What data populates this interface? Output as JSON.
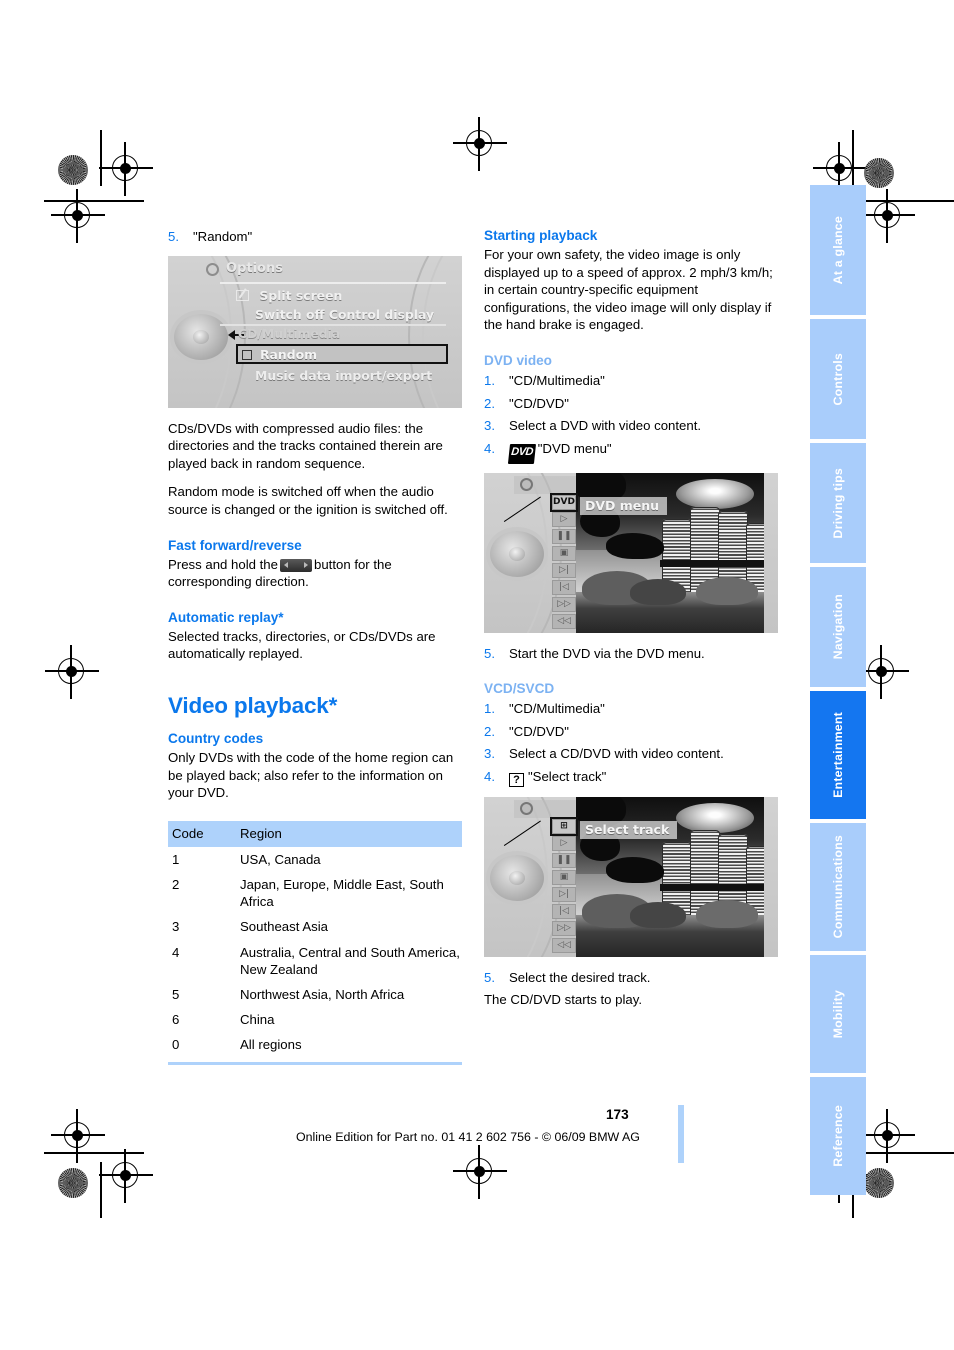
{
  "page": {
    "number": "173",
    "footer_note": "Online Edition for Part no. 01 41 2 602 756 - © 06/09 BMW AG"
  },
  "left_column": {
    "step5_random": {
      "num": "5.",
      "text": "\"Random\""
    },
    "options_screenshot": {
      "title_bar": "Options",
      "gear_icon": "gear-icon",
      "menu_items": [
        {
          "label": "Split screen",
          "checkbox": "checked"
        },
        {
          "label": "Switch off Control display",
          "checkbox": "none"
        },
        {
          "label": "CD/Multimedia",
          "checkbox": "none"
        },
        {
          "label": "Random",
          "checkbox": "unchecked",
          "selected": true
        },
        {
          "label": "Music data import/export",
          "checkbox": "none"
        }
      ]
    },
    "paragraphs": [
      "CDs/DVDs with compressed audio files: the directories and the tracks contained therein are played back in random sequence.",
      "Random mode is switched off when the audio source is changed or the ignition is switched off."
    ],
    "fast_forward": {
      "heading": "Fast forward/reverse",
      "text_before": "Press and hold the",
      "button_icon": "rocker-button-icon",
      "text_after": "button for the corresponding direction."
    },
    "automatic_replay": {
      "heading": "Automatic replay*",
      "text": "Selected tracks, directories, or CDs/DVDs are automatically replayed."
    },
    "video_playback": {
      "heading": "Video playback*",
      "country_codes": {
        "heading": "Country codes",
        "intro": "Only DVDs with the code of the home region can be played back; also refer to the information on your DVD.",
        "columns": [
          "Code",
          "Region"
        ],
        "rows": [
          {
            "code": "1",
            "region": "USA, Canada"
          },
          {
            "code": "2",
            "region": "Japan, Europe, Middle East, South Africa"
          },
          {
            "code": "3",
            "region": "Southeast Asia"
          },
          {
            "code": "4",
            "region": "Australia, Central and South America, New Zealand"
          },
          {
            "code": "5",
            "region": "Northwest Asia, North Africa"
          },
          {
            "code": "6",
            "region": "China"
          },
          {
            "code": "0",
            "region": "All regions"
          }
        ]
      }
    }
  },
  "right_column": {
    "starting_playback": {
      "heading": "Starting playback",
      "text": "For your own safety, the video image is only displayed up to a speed of approx. 2 mph/3 km/h; in certain country-specific equipment configurations, the video image will only display if the hand brake is engaged."
    },
    "dvd_video": {
      "heading": "DVD video",
      "steps": [
        {
          "num": "1.",
          "text": "\"CD/Multimedia\""
        },
        {
          "num": "2.",
          "text": "\"CD/DVD\""
        },
        {
          "num": "3.",
          "text": "Select a DVD with video content."
        },
        {
          "num": "4.",
          "icon": "dvd-logo-icon",
          "icon_text": "DVD",
          "text": "\"DVD menu\""
        }
      ],
      "screenshot": {
        "gear_icon": "gear-icon",
        "selected_label": "DVD menu",
        "selected_icon": "dvd-logo-icon",
        "control_icons": [
          "dvd",
          "play",
          "pause",
          "stop",
          "next-track",
          "previous-track",
          "fast-forward",
          "rewind"
        ],
        "video_content": "BMW four-cylinder tower building"
      },
      "step5": {
        "num": "5.",
        "text": "Start the DVD via the DVD menu."
      }
    },
    "vcd_svcd": {
      "heading": "VCD/SVCD",
      "steps": [
        {
          "num": "1.",
          "text": "\"CD/Multimedia\""
        },
        {
          "num": "2.",
          "text": "\"CD/DVD\""
        },
        {
          "num": "3.",
          "text": "Select a CD/DVD with video content."
        },
        {
          "num": "4.",
          "icon": "question-box-icon",
          "icon_text": "?",
          "text": "\"Select track\""
        }
      ],
      "screenshot": {
        "gear_icon": "gear-icon",
        "selected_label": "Select track",
        "selected_icon": "select-track-icon",
        "control_icons": [
          "select-track",
          "play",
          "pause",
          "stop",
          "next-track",
          "previous-track",
          "fast-forward",
          "rewind"
        ],
        "video_content": "BMW four-cylinder tower building"
      },
      "step5": {
        "num": "5.",
        "text": "Select the desired track."
      },
      "closing": "The CD/DVD starts to play."
    }
  },
  "side_tabs": {
    "items": [
      {
        "label": "At a glance",
        "active": false
      },
      {
        "label": "Controls",
        "active": false
      },
      {
        "label": "Driving tips",
        "active": false
      },
      {
        "label": "Navigation",
        "active": false
      },
      {
        "label": "Entertainment",
        "active": true
      },
      {
        "label": "Communications",
        "active": false
      },
      {
        "label": "Mobility",
        "active": false
      },
      {
        "label": "Reference",
        "active": false
      }
    ]
  },
  "colors": {
    "heading_blue": "#0b78ec",
    "subheading_light_blue": "#7cb2f2",
    "tab_inactive": "#a9cdfb",
    "tab_active": "#1476f0",
    "table_header": "#aed2fb"
  }
}
